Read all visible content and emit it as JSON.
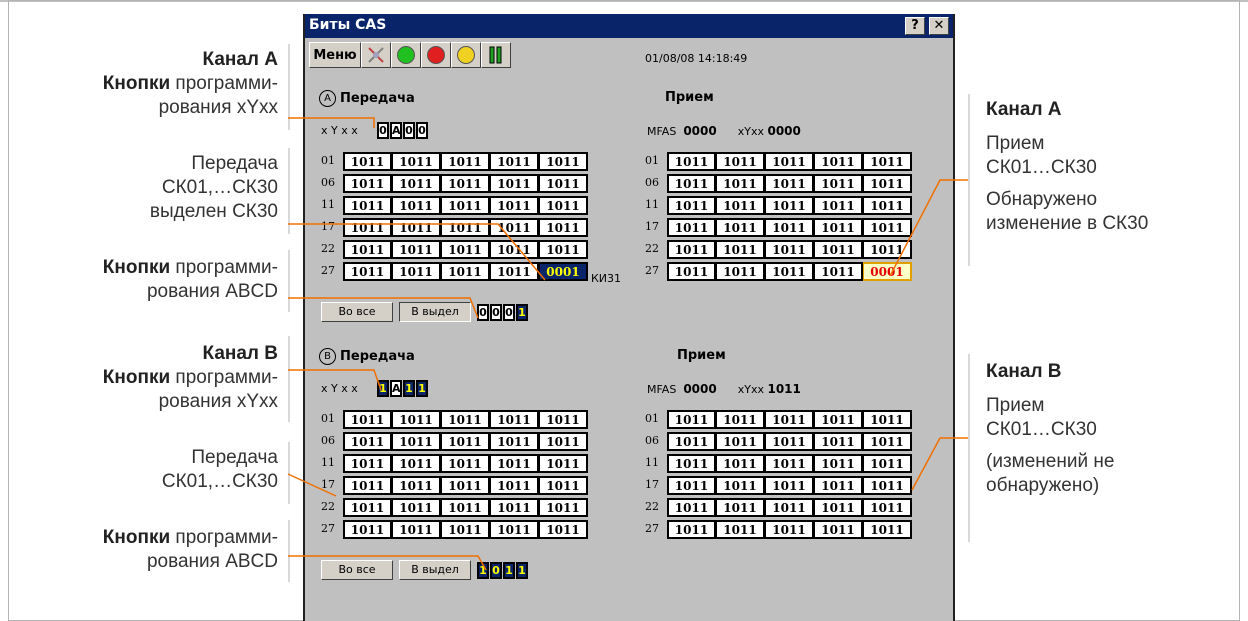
{
  "window": {
    "title": "Биты CAS",
    "help_label": "?",
    "close_label": "✕",
    "menu_label": "Меню",
    "datetime": "01/08/08 14:18:49",
    "toolbar_icons": [
      "tools-icon",
      "green-circle-icon",
      "red-circle-icon",
      "yellow-circle-icon",
      "pause-icon"
    ]
  },
  "channel_a": {
    "circle": "A",
    "tx_title": "Передача",
    "rx_title": "Прием",
    "xyxx_label": "x Y x x",
    "xyxx_bits": [
      "0",
      "A",
      "0",
      "0"
    ],
    "mfas_label": "MFAS",
    "mfas_value": "0000",
    "rx_xyxx_label": "xYxx",
    "rx_xyxx_value": "0000",
    "row_labels": [
      "01",
      "06",
      "11",
      "17",
      "22",
      "27"
    ],
    "tx_rows": [
      [
        "1011",
        "1011",
        "1011",
        "1011",
        "1011"
      ],
      [
        "1011",
        "1011",
        "1011",
        "1011",
        "1011"
      ],
      [
        "1011",
        "1011",
        "1011",
        "1011",
        "1011"
      ],
      [
        "1011",
        "1011",
        "1011",
        "1011",
        "1011"
      ],
      [
        "1011",
        "1011",
        "1011",
        "1011",
        "1011"
      ],
      [
        "1011",
        "1011",
        "1011",
        "1011",
        "0001"
      ]
    ],
    "rx_rows": [
      [
        "1011",
        "1011",
        "1011",
        "1011",
        "1011"
      ],
      [
        "1011",
        "1011",
        "1011",
        "1011",
        "1011"
      ],
      [
        "1011",
        "1011",
        "1011",
        "1011",
        "1011"
      ],
      [
        "1011",
        "1011",
        "1011",
        "1011",
        "1011"
      ],
      [
        "1011",
        "1011",
        "1011",
        "1011",
        "1011"
      ],
      [
        "1011",
        "1011",
        "1011",
        "1011",
        "0001"
      ]
    ],
    "ki31_label": "КИ31",
    "btn_all": "Во все",
    "btn_sel": "В выдел",
    "abcd_bits": [
      "0",
      "0",
      "0",
      "1"
    ]
  },
  "channel_b": {
    "circle": "B",
    "tx_title": "Передача",
    "rx_title": "Прием",
    "xyxx_label": "x Y x x",
    "xyxx_bits": [
      "1",
      "A",
      "1",
      "1"
    ],
    "mfas_label": "MFAS",
    "mfas_value": "0000",
    "rx_xyxx_label": "xYxx",
    "rx_xyxx_value": "1011",
    "row_labels": [
      "01",
      "06",
      "11",
      "17",
      "22",
      "27"
    ],
    "tx_rows": [
      [
        "1011",
        "1011",
        "1011",
        "1011",
        "1011"
      ],
      [
        "1011",
        "1011",
        "1011",
        "1011",
        "1011"
      ],
      [
        "1011",
        "1011",
        "1011",
        "1011",
        "1011"
      ],
      [
        "1011",
        "1011",
        "1011",
        "1011",
        "1011"
      ],
      [
        "1011",
        "1011",
        "1011",
        "1011",
        "1011"
      ],
      [
        "1011",
        "1011",
        "1011",
        "1011",
        "1011"
      ]
    ],
    "rx_rows": [
      [
        "1011",
        "1011",
        "1011",
        "1011",
        "1011"
      ],
      [
        "1011",
        "1011",
        "1011",
        "1011",
        "1011"
      ],
      [
        "1011",
        "1011",
        "1011",
        "1011",
        "1011"
      ],
      [
        "1011",
        "1011",
        "1011",
        "1011",
        "1011"
      ],
      [
        "1011",
        "1011",
        "1011",
        "1011",
        "1011"
      ],
      [
        "1011",
        "1011",
        "1011",
        "1011",
        "1011"
      ]
    ],
    "btn_all": "Во все",
    "btn_sel": "В выдел",
    "abcd_bits": [
      "1",
      "0",
      "1",
      "1"
    ]
  },
  "annotations_left": {
    "a_title": "Канал A",
    "a_xyxx_bold": "Кнопки",
    "a_xyxx_rest1": " программи-",
    "a_xyxx_rest2": "рования xYxx",
    "a_tx1": "Передача",
    "a_tx2": "СК01,…СК30",
    "a_tx3": "выделен СК30",
    "a_abcd_bold": "Кнопки",
    "a_abcd_rest1": " программи-",
    "a_abcd_rest2": "рования ABCD",
    "b_title": "Канал B",
    "b_xyxx_bold": "Кнопки",
    "b_xyxx_rest1": " программи-",
    "b_xyxx_rest2": "рования xYxx",
    "b_tx1": "Передача",
    "b_tx2": "СК01,…СК30",
    "b_abcd_bold": "Кнопки",
    "b_abcd_rest1": " программи-",
    "b_abcd_rest2": "рования ABCD"
  },
  "annotations_right": {
    "a_title": "Канал A",
    "a_l1": "Прием",
    "a_l2": "СК01…СК30",
    "a_l3": "Обнаружено",
    "a_l4": "изменение в СК30",
    "b_title": "Канал B",
    "b_l1": "Прием",
    "b_l2": "СК01…СК30",
    "b_l3": "(изменений не",
    "b_l4": "обнаружено)"
  },
  "colors": {
    "leader_line": "#f07000",
    "selected_bg": "#0a246a",
    "selected_fg": "#ffff00",
    "changed_fg": "#e00000"
  }
}
